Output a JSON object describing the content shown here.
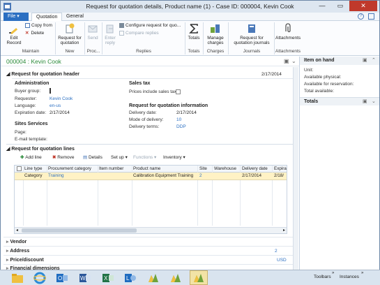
{
  "window": {
    "title": "Request for quotation details, Product name (1) - Case ID: 000004, Kevin Cook"
  },
  "tabs": {
    "file": "File",
    "quotation": "Quotation",
    "general": "General"
  },
  "ribbon": {
    "edit": "Edit",
    "record": "Record",
    "copy_from": "Copy from",
    "delete": "Delete",
    "maintain": "Maintain",
    "request_for_quotation": "Request for quotation",
    "new": "New",
    "send": "Send",
    "proc": "Proc...",
    "enter_reply": "Enter reply",
    "configure_request": "Configure request for quo...",
    "compare_replies": "Compare replies",
    "replies": "Replies",
    "totals": "Totals",
    "totals_group": "Totals",
    "manage_charges": "Manage charges",
    "charges": "Charges",
    "rfq_journals": "Request for quotation journals",
    "journals": "Journals",
    "attachments": "Attachments",
    "attachments_group": "Attachments"
  },
  "record_header": "000004 : Kevin Cook",
  "header_section": {
    "title": "Request for quotation header",
    "date": "2/17/2014",
    "administration": "Administration",
    "buyer_group_label": "Buyer group:",
    "buyer_group_value": "",
    "requester_label": "Requester:",
    "requester_value": "Kevin Cook",
    "language_label": "Language:",
    "language_value": "en-us",
    "expiration_label": "Expiration date:",
    "expiration_value": "2/17/2014",
    "sites_services": "Sites Services",
    "page_label": "Page:",
    "email_template_label": "E-mail template:",
    "sales_tax": "Sales tax",
    "prices_include_tax": "Prices include sales tax:",
    "rfq_information": "Request for quotation information",
    "delivery_date_label": "Delivery date:",
    "delivery_date_value": "2/17/2014",
    "mode_label": "Mode of delivery:",
    "mode_value": "10",
    "terms_label": "Delivery terms:",
    "terms_value": "DDP"
  },
  "lines_section": {
    "title": "Request for quotation lines",
    "add_line": "Add line",
    "remove": "Remove",
    "details": "Details",
    "set_up": "Set up",
    "functions": "Functions",
    "inventory": "Inventory",
    "columns": [
      "Line type",
      "Procurement category",
      "Item number",
      "Product name",
      "Site",
      "Warehouse",
      "Delivery date",
      "Expira"
    ],
    "rows": [
      [
        "Category",
        "Training",
        "",
        "Calibration Equipment Training",
        "2",
        "",
        "2/17/2014",
        "2/18/"
      ]
    ]
  },
  "collapsed_sections": {
    "vendor": "Vendor",
    "address": "Address",
    "address_value": "2",
    "price_discount": "Price/discount",
    "price_value": "USD",
    "financial_dimensions": "Financial dimensions"
  },
  "side_panel": {
    "item_on_hand": "Item on hand",
    "unit": "Unit:",
    "available_physical": "Available physical:",
    "available_reservation": "Available for reservation:",
    "total_available": "Total available:",
    "totals": "Totals"
  },
  "taskbar": {
    "toolbars": "Toolbars",
    "instances": "Instances"
  },
  "colors": {
    "accent": "#2b6fc2",
    "title_green": "#2a8a3a",
    "selected_row": "#fff2c5"
  }
}
